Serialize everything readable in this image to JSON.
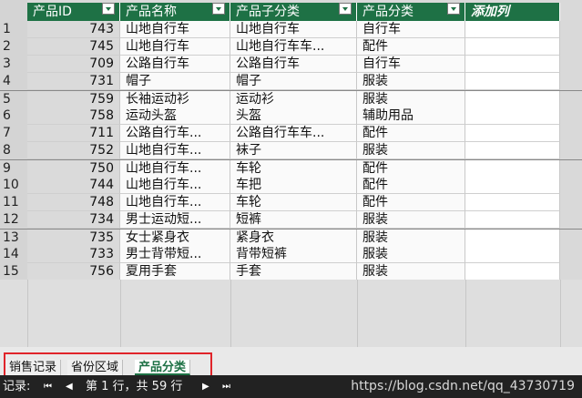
{
  "columns": [
    {
      "label": "产品ID",
      "has_filter": true
    },
    {
      "label": "产品名称",
      "has_filter": true
    },
    {
      "label": "产品子分类",
      "has_filter": true
    },
    {
      "label": "产品分类",
      "has_filter": true
    },
    {
      "label": "添加列",
      "has_filter": false
    }
  ],
  "rows": [
    {
      "n": "1",
      "id": "743",
      "name": "山地自行车",
      "sub": "山地自行车",
      "cat": "自行车"
    },
    {
      "n": "2",
      "id": "745",
      "name": "山地自行车",
      "sub": "山地自行车车...",
      "cat": "配件"
    },
    {
      "n": "3",
      "id": "709",
      "name": "公路自行车",
      "sub": "公路自行车",
      "cat": "自行车"
    },
    {
      "n": "4",
      "id": "731",
      "name": "帽子",
      "sub": "帽子",
      "cat": "服装"
    },
    {
      "n": "5",
      "id": "759",
      "name": "长袖运动衫",
      "sub": "运动衫",
      "cat": "服装"
    },
    {
      "n": "6",
      "id": "758",
      "name": "运动头盔",
      "sub": "头盔",
      "cat": "辅助用品"
    },
    {
      "n": "7",
      "id": "711",
      "name": "公路自行车...",
      "sub": "公路自行车车...",
      "cat": "配件"
    },
    {
      "n": "8",
      "id": "752",
      "name": "山地自行车...",
      "sub": "袜子",
      "cat": "服装"
    },
    {
      "n": "9",
      "id": "750",
      "name": "山地自行车...",
      "sub": "车轮",
      "cat": "配件"
    },
    {
      "n": "10",
      "id": "744",
      "name": "山地自行车...",
      "sub": "车把",
      "cat": "配件"
    },
    {
      "n": "11",
      "id": "748",
      "name": "山地自行车...",
      "sub": "车轮",
      "cat": "配件"
    },
    {
      "n": "12",
      "id": "734",
      "name": "男士运动短...",
      "sub": "短裤",
      "cat": "服装"
    },
    {
      "n": "13",
      "id": "735",
      "name": "女士紧身衣",
      "sub": "紧身衣",
      "cat": "服装"
    },
    {
      "n": "14",
      "id": "733",
      "name": "男士背带短...",
      "sub": "背带短裤",
      "cat": "服装"
    },
    {
      "n": "15",
      "id": "756",
      "name": "夏用手套",
      "sub": "手套",
      "cat": "服装"
    }
  ],
  "tabs": [
    "销售记录",
    "省份区域",
    "产品分类"
  ],
  "active_tab": "产品分类",
  "status": {
    "record_label": "记录:",
    "first": "⏮",
    "prev": "◀",
    "position": "第 1 行，共 59 行",
    "next": "▶",
    "last": "⏭"
  },
  "watermark": "https://blog.csdn.net/qq_43730719",
  "colors": {
    "header": "#1e7145",
    "highlight": "#e0242a"
  }
}
